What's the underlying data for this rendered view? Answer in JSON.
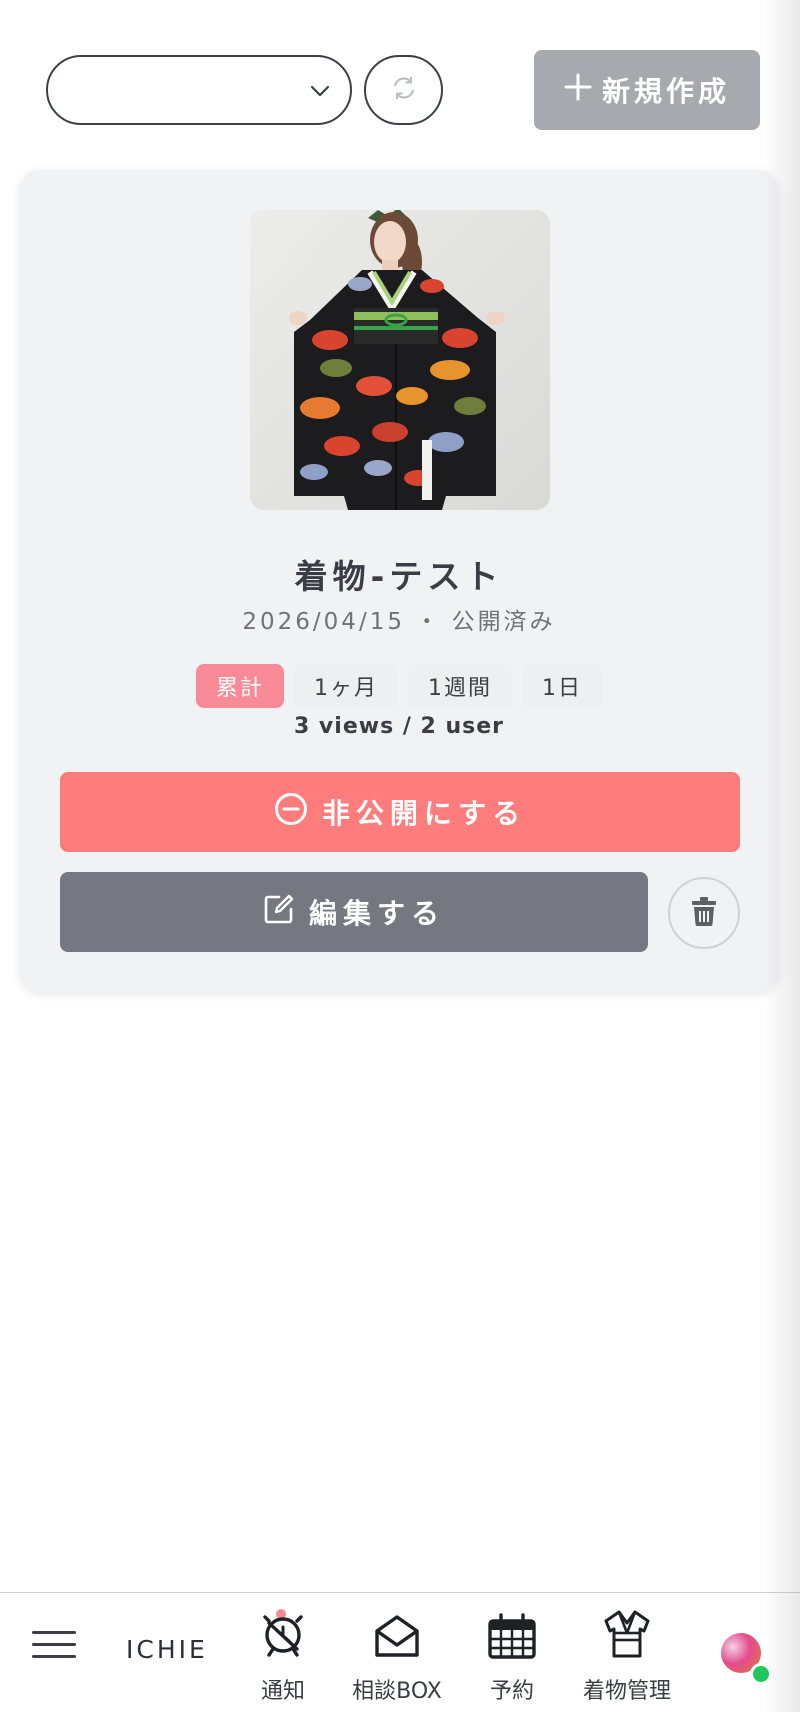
{
  "toolbar": {
    "select_value": "",
    "new_button_label": "新規作成"
  },
  "item": {
    "title": "着物-テスト",
    "date": "2026/04/15",
    "separator": "・",
    "status": "公開済み",
    "ranges": [
      "累計",
      "1ヶ月",
      "1週間",
      "1日"
    ],
    "active_range": "累計",
    "stats": "3 views / 2 user",
    "unpublish_label": "非公開にする",
    "edit_label": "編集する"
  },
  "nav": {
    "brand": "ICHIE",
    "items": [
      {
        "label": "通知",
        "icon": "alarm-icon"
      },
      {
        "label": "相談BOX",
        "icon": "mail-icon"
      },
      {
        "label": "予約",
        "icon": "calendar-icon"
      },
      {
        "label": "着物管理",
        "icon": "kimono-icon"
      }
    ]
  },
  "colors": {
    "accent_pink": "#f98a97",
    "unpublish_red": "#fe7c7c",
    "edit_gray": "#757880",
    "new_button_gray": "#a6a9ae",
    "online_green": "#22c55e"
  }
}
